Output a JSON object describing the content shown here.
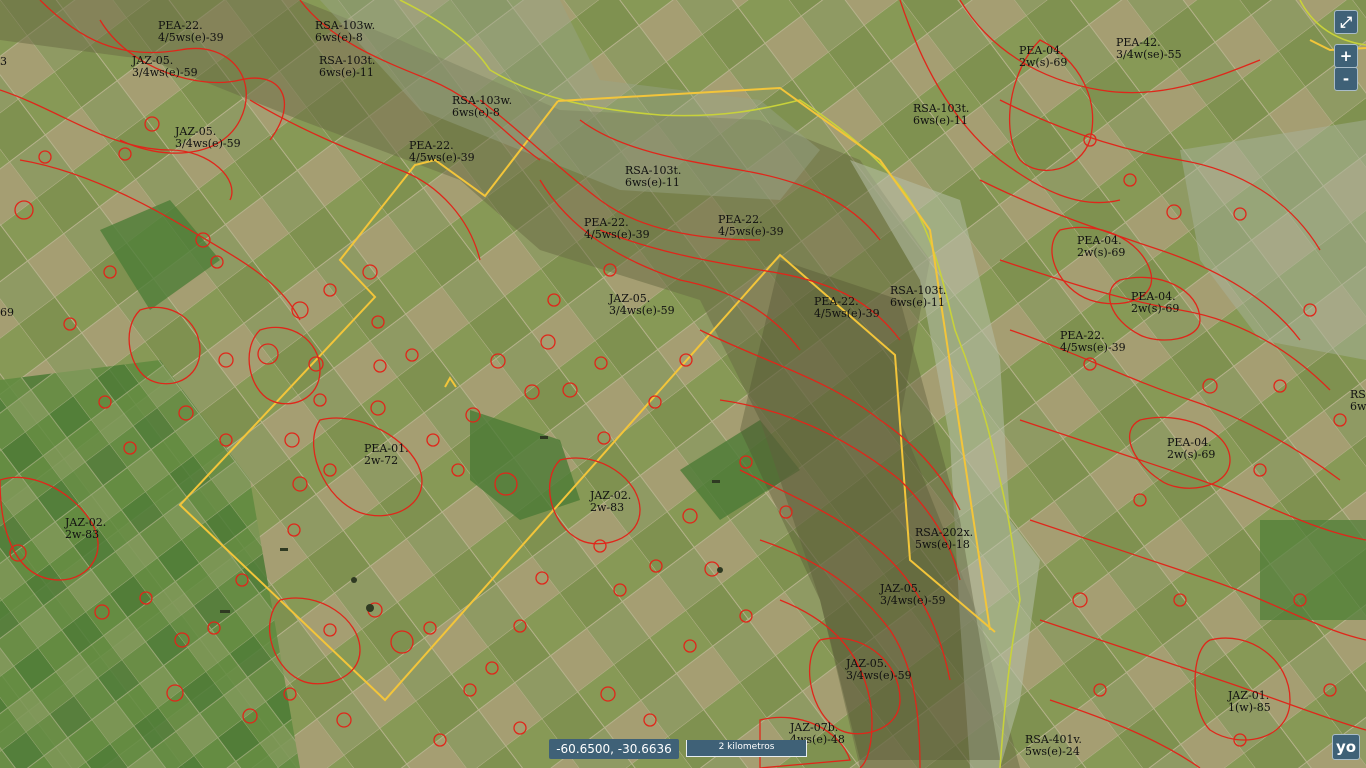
{
  "controls": {
    "fullscreen_icon": "⤢",
    "zoom_in": "+",
    "zoom_out": "-"
  },
  "coordinates": "-60.6500, -30.6636",
  "scale_label": "2 kilometros",
  "logo_text": "yo",
  "colors": {
    "soil_boundary": "#e0261a",
    "parcel_boundary": "#f3c53a",
    "river": "#c8d23a",
    "control_bg": "#3f6177"
  },
  "labels": [
    {
      "code": "PEA-22.",
      "class": "4/5ws(e)-39"
    },
    {
      "code": "RSA-103w.",
      "class": "6ws(e)-8"
    },
    {
      "code": "RSA-103t.",
      "class": "6ws(e)-11"
    },
    {
      "code": "JAZ-05.",
      "class": "3/4ws(e)-59"
    },
    {
      "code": "RSA-103w.",
      "class": "6ws(e)-8"
    },
    {
      "code": "JAZ-05.",
      "class": "3/4ws(e)-59"
    },
    {
      "code": "PEA-22.",
      "class": "4/5ws(e)-39"
    },
    {
      "code": "PEA-04.",
      "class": "2w(s)-69"
    },
    {
      "code": "PEA-42.",
      "class": "3/4w(se)-55"
    },
    {
      "code": "RSA-103t.",
      "class": "6ws(e)-11"
    },
    {
      "code": "RSA-103t.",
      "class": "6ws(e)-11"
    },
    {
      "code": "PEA-22.",
      "class": "4/5ws(e)-39"
    },
    {
      "code": "PEA-22.",
      "class": "4/5ws(e)-39"
    },
    {
      "code": "PEA-04.",
      "class": "2w(s)-69"
    },
    {
      "code": "JAZ-05.",
      "class": "3/4ws(e)-59"
    },
    {
      "code": "PEA-22.",
      "class": "4/5ws(e)-39"
    },
    {
      "code": "RSA-103t.",
      "class": "6ws(e)-11"
    },
    {
      "code": "PEA-04.",
      "class": "2w(s)-69"
    },
    {
      "code": "PEA-22.",
      "class": "4/5ws(e)-39"
    },
    {
      "code": "PEA-01.",
      "class": "2w-72"
    },
    {
      "code": "JAZ-02.",
      "class": "2w-83"
    },
    {
      "code": "PEA-04.",
      "class": "2w(s)-69"
    },
    {
      "code": "JAZ-02.",
      "class": "2w-83"
    },
    {
      "code": "RSA-202x.",
      "class": "5ws(e)-18"
    },
    {
      "code": "JAZ-05.",
      "class": "3/4ws(e)-59"
    },
    {
      "code": "JAZ-05.",
      "class": "3/4ws(e)-59"
    },
    {
      "code": "JAZ-01.",
      "class": "1(w)-85"
    },
    {
      "code": "JAZ-07b.",
      "class": "4ws(e)-48"
    },
    {
      "code": "RSA-401v.",
      "class": "5ws(e)-24"
    },
    {
      "code": "",
      "class": "4/5ws(e)-39"
    },
    {
      "code": "",
      "class": "3"
    },
    {
      "code": "",
      "class": "69"
    },
    {
      "code": "RS",
      "class": "6w"
    }
  ]
}
